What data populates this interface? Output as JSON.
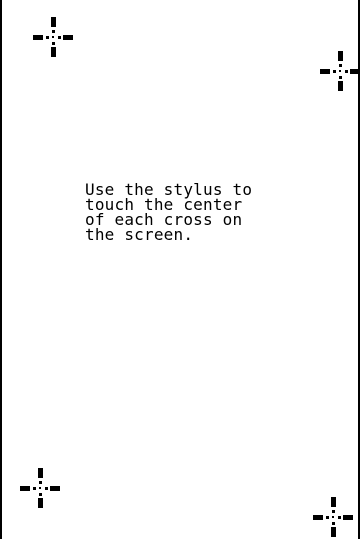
{
  "screen": {
    "background_color": "#ffffff",
    "foreground_color": "#000000",
    "instructions": [
      "Use the stylus to",
      "touch the center",
      "of each cross on",
      "the screen."
    ],
    "targets": [
      {
        "name": "crosshair-top-left",
        "icon": "crosshair-icon"
      },
      {
        "name": "crosshair-top-right",
        "icon": "crosshair-icon"
      },
      {
        "name": "crosshair-bottom-left",
        "icon": "crosshair-icon"
      },
      {
        "name": "crosshair-bottom-right",
        "icon": "crosshair-icon"
      }
    ]
  }
}
